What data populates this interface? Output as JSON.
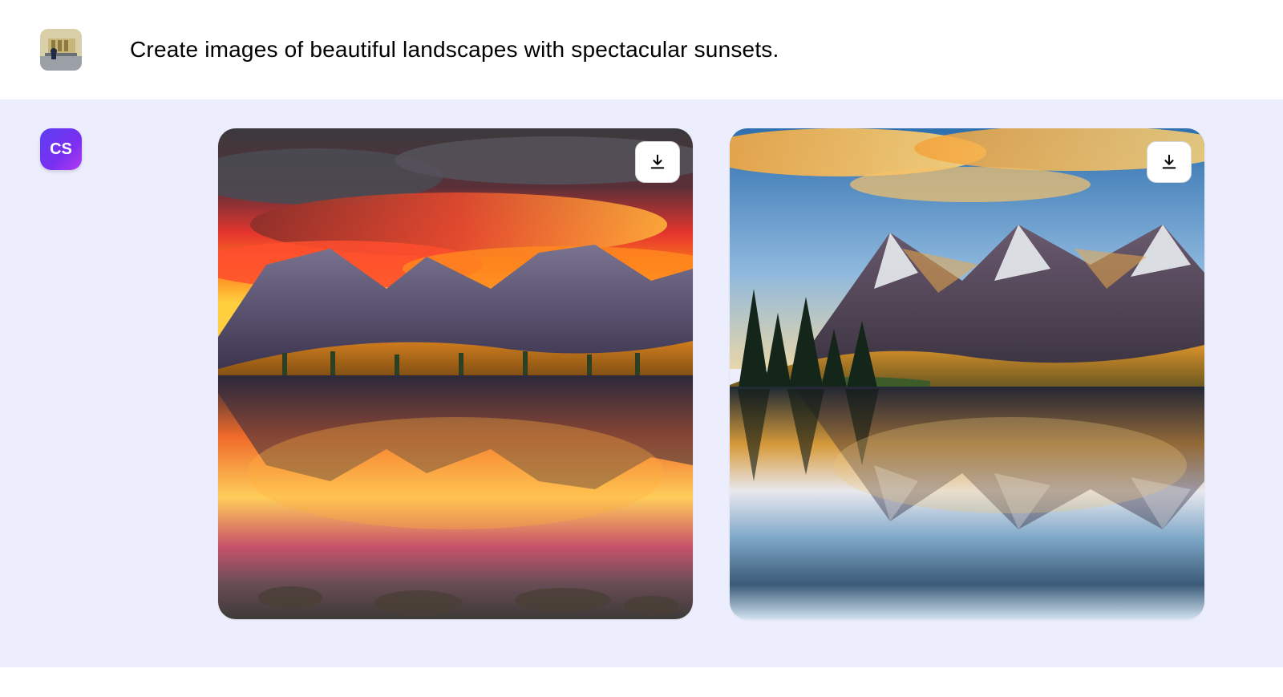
{
  "user_message": "Create images of beautiful landscapes with spectacular sunsets.",
  "assistant_badge": "CS",
  "icons": {
    "download": "download-icon"
  },
  "images": [
    {
      "alt": "Mountain lake with fiery red and orange sunset sky reflected in water"
    },
    {
      "alt": "Snow-capped mountains and pine trees at golden sunset reflected in calm lake"
    }
  ]
}
